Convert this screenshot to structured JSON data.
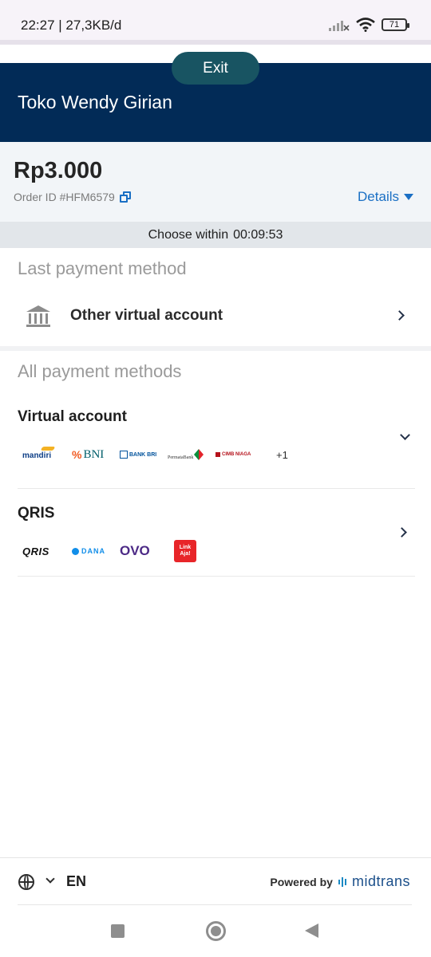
{
  "status_bar": {
    "time_speed": "22:27 | 27,3KB/d",
    "battery": "71"
  },
  "header": {
    "merchant_name": "Toko Wendy Girian",
    "exit_label": "Exit"
  },
  "order": {
    "amount": "Rp3.000",
    "order_id": "Order ID #HFM6579",
    "details_label": "Details"
  },
  "timer": {
    "label": "Choose within",
    "value": "00:09:53"
  },
  "last_payment": {
    "title": "Last payment method",
    "item_label": "Other virtual account"
  },
  "all_payments": {
    "title": "All payment methods",
    "groups": [
      {
        "title": "Virtual account",
        "logos": [
          "mandiri",
          "BNI",
          "BANK BRI",
          "PermataBank",
          "CIMB NIAGA"
        ],
        "more": "+1"
      },
      {
        "title": "QRIS",
        "logos": [
          "QRIS",
          "DANA",
          "OVO",
          "Link Aja!"
        ]
      }
    ]
  },
  "footer": {
    "language": "EN",
    "powered_by": "Powered by",
    "brand": "midtrans"
  },
  "colors": {
    "header_bg": "#022b57",
    "exit_bg": "#185462",
    "accent_blue": "#1a6fc4",
    "ovo_purple": "#4c2a86",
    "linkaja_red": "#e82529",
    "bni_orange": "#f15a22",
    "bni_navy": "#005e6a",
    "bri_blue": "#00529c"
  }
}
